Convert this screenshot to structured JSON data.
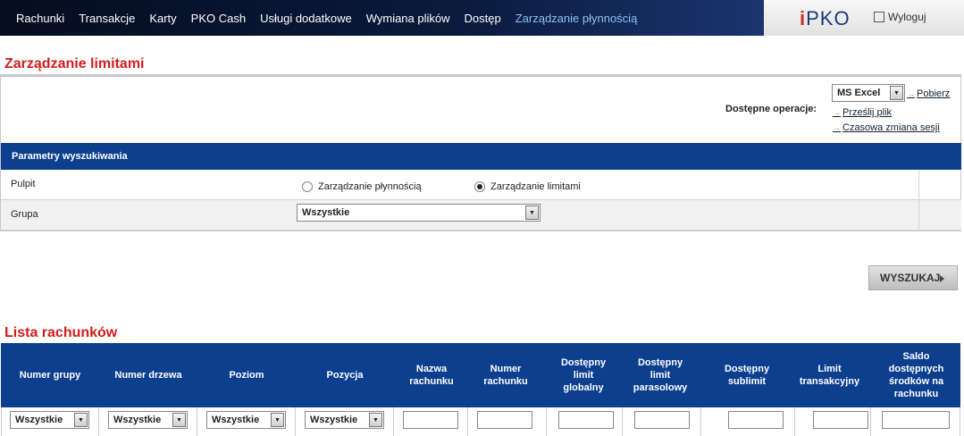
{
  "nav": {
    "items": [
      "Rachunki",
      "Transakcje",
      "Karty",
      "PKO Cash",
      "Usługi dodatkowe",
      "Wymiana plików",
      "Dostęp",
      "Zarządzanie płynnością"
    ],
    "logo_i": "i",
    "logo_text": "PKO",
    "logout": "Wyloguj"
  },
  "page": {
    "title": "Zarządzanie limitami",
    "list_title": "Lista rachunków"
  },
  "operations": {
    "label": "Dostępne operacje:",
    "format_selected": "MS Excel",
    "links": [
      "Pobierz",
      "Prześlij plik",
      "Czasowa zmiana sesji"
    ]
  },
  "search": {
    "header": "Parametry wyszukiwania",
    "pulpit_label": "Pulpit",
    "radios": [
      {
        "label": "Zarządzanie płynnością",
        "checked": false
      },
      {
        "label": "Zarządzanie limitami",
        "checked": true
      }
    ],
    "group_label": "Grupa",
    "group_selected": "Wszystkie",
    "button": "WYSZUKAJ"
  },
  "accounts_table": {
    "columns": [
      "Numer grupy",
      "Numer drzewa",
      "Poziom",
      "Pozycja",
      "Nazwa rachunku",
      "Numer rachunku",
      "Dostępny limit globalny",
      "Dostępny limit parasolowy",
      "Dostępny sublimit",
      "Limit transakcyjny",
      "Saldo dostępnych środków na rachunku"
    ],
    "filter_select_value": "Wszystkie"
  },
  "colors": {
    "nav_bg": "#0a1a3d",
    "header_blue": "#0d3f8f",
    "title_red": "#d01d1d",
    "active_nav": "#8fc0f2"
  }
}
